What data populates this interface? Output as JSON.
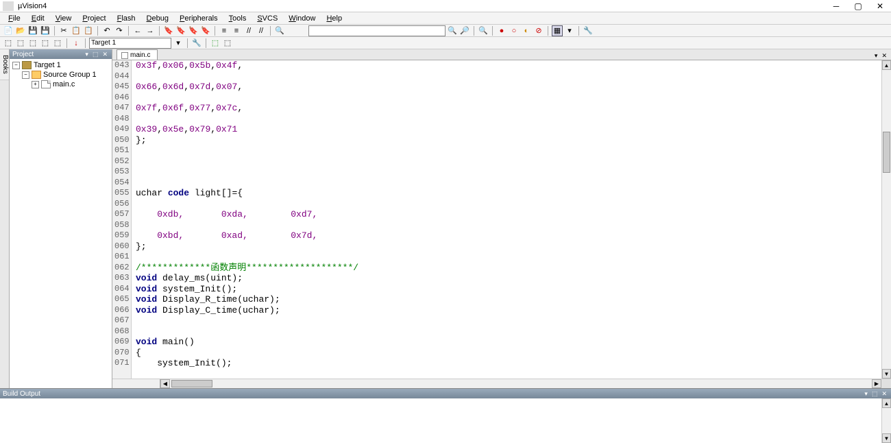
{
  "title": "µVision4",
  "menu": [
    "File",
    "Edit",
    "View",
    "Project",
    "Flash",
    "Debug",
    "Peripherals",
    "Tools",
    "SVCS",
    "Window",
    "Help"
  ],
  "target_combo": "Target 1",
  "project_panel": {
    "title": "Project"
  },
  "tree": {
    "root": "Target 1",
    "group": "Source Group 1",
    "file": "main.c"
  },
  "editor": {
    "tab": "main.c",
    "startLine": 43,
    "lines": [
      {
        "segs": [
          {
            "t": "0x3f",
            "c": "hex"
          },
          {
            "t": ",",
            "c": ""
          },
          {
            "t": "0x06",
            "c": "hex"
          },
          {
            "t": ",",
            "c": ""
          },
          {
            "t": "0x5b",
            "c": "hex"
          },
          {
            "t": ",",
            "c": ""
          },
          {
            "t": "0x4f",
            "c": "hex"
          },
          {
            "t": ",",
            "c": ""
          }
        ]
      },
      {
        "segs": []
      },
      {
        "segs": [
          {
            "t": "0x66",
            "c": "hex"
          },
          {
            "t": ",",
            "c": ""
          },
          {
            "t": "0x6d",
            "c": "hex"
          },
          {
            "t": ",",
            "c": ""
          },
          {
            "t": "0x7d",
            "c": "hex"
          },
          {
            "t": ",",
            "c": ""
          },
          {
            "t": "0x07",
            "c": "hex"
          },
          {
            "t": ",",
            "c": ""
          }
        ]
      },
      {
        "segs": []
      },
      {
        "segs": [
          {
            "t": "0x7f",
            "c": "hex"
          },
          {
            "t": ",",
            "c": ""
          },
          {
            "t": "0x6f",
            "c": "hex"
          },
          {
            "t": ",",
            "c": ""
          },
          {
            "t": "0x77",
            "c": "hex"
          },
          {
            "t": ",",
            "c": ""
          },
          {
            "t": "0x7c",
            "c": "hex"
          },
          {
            "t": ",",
            "c": ""
          }
        ]
      },
      {
        "segs": []
      },
      {
        "segs": [
          {
            "t": "0x39",
            "c": "hex"
          },
          {
            "t": ",",
            "c": ""
          },
          {
            "t": "0x5e",
            "c": "hex"
          },
          {
            "t": ",",
            "c": ""
          },
          {
            "t": "0x79",
            "c": "hex"
          },
          {
            "t": ",",
            "c": ""
          },
          {
            "t": "0x71",
            "c": "hex"
          }
        ]
      },
      {
        "segs": [
          {
            "t": "};",
            "c": ""
          }
        ]
      },
      {
        "segs": []
      },
      {
        "segs": []
      },
      {
        "segs": []
      },
      {
        "segs": []
      },
      {
        "segs": [
          {
            "t": "uchar ",
            "c": ""
          },
          {
            "t": "code",
            "c": "kw"
          },
          {
            "t": " light[]={",
            "c": ""
          }
        ]
      },
      {
        "segs": []
      },
      {
        "segs": [
          {
            "t": "    0xdb,       0xda,        0xd7,",
            "c": "hex"
          }
        ]
      },
      {
        "segs": []
      },
      {
        "segs": [
          {
            "t": "    0xbd,       0xad,        0x7d,",
            "c": "hex"
          }
        ]
      },
      {
        "segs": [
          {
            "t": "};",
            "c": ""
          }
        ]
      },
      {
        "segs": []
      },
      {
        "segs": [
          {
            "t": "/*************",
            "c": "cmt"
          },
          {
            "t": "函数声明",
            "c": "cjk"
          },
          {
            "t": "********************/",
            "c": "cmt"
          }
        ]
      },
      {
        "segs": [
          {
            "t": "void",
            "c": "kw"
          },
          {
            "t": " delay_ms(uint);",
            "c": ""
          }
        ]
      },
      {
        "segs": [
          {
            "t": "void",
            "c": "kw"
          },
          {
            "t": " system_Init();",
            "c": ""
          }
        ]
      },
      {
        "segs": [
          {
            "t": "void",
            "c": "kw"
          },
          {
            "t": " Display_R_time(uchar);",
            "c": ""
          }
        ]
      },
      {
        "segs": [
          {
            "t": "void",
            "c": "kw"
          },
          {
            "t": " Display_C_time(uchar);",
            "c": ""
          }
        ]
      },
      {
        "segs": []
      },
      {
        "segs": []
      },
      {
        "segs": [
          {
            "t": "void",
            "c": "kw"
          },
          {
            "t": " main()",
            "c": ""
          }
        ]
      },
      {
        "segs": [
          {
            "t": "{",
            "c": ""
          }
        ]
      },
      {
        "segs": [
          {
            "t": "    system_Init();",
            "c": ""
          }
        ]
      }
    ]
  },
  "build_output": {
    "title": "Build Output"
  },
  "sidebar_tab": "Books"
}
